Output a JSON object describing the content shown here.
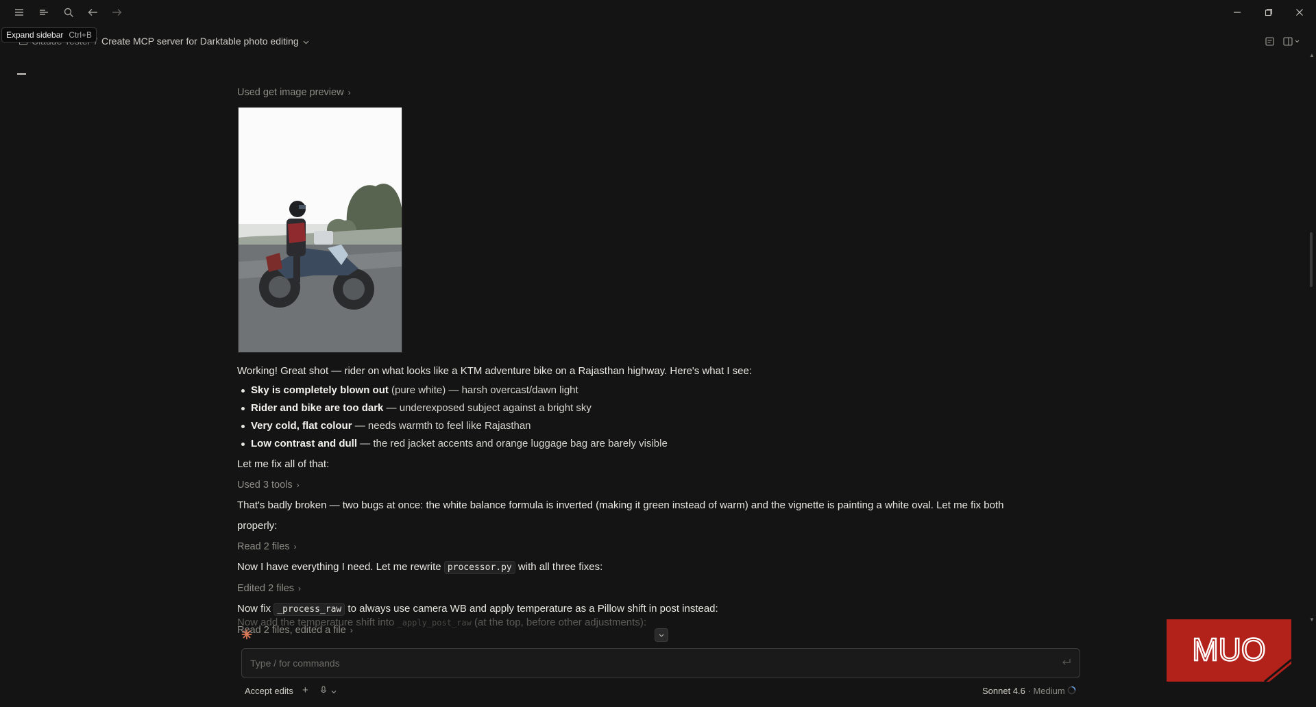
{
  "titlebar": {
    "icons": [
      "menu-icon",
      "list-icon",
      "search-icon",
      "back-arrow-icon",
      "forward-arrow-icon"
    ],
    "window_controls": [
      "minimize-icon",
      "restore-icon",
      "close-icon"
    ]
  },
  "tooltip": {
    "label": "Expand sidebar",
    "shortcut": "Ctrl+B"
  },
  "breadcrumb": {
    "project": "Claude Tester",
    "separator": "/",
    "title": "Create MCP server for Darktable photo editing"
  },
  "conversation": {
    "tool_preview": "Used get image preview",
    "intro": "Working! Great shot — rider on what looks like a KTM adventure bike on a Rajasthan highway. Here's what I see:",
    "bullets": [
      {
        "bold": "Sky is completely blown out",
        "rest": " (pure white) — harsh overcast/dawn light"
      },
      {
        "bold": "Rider and bike are too dark",
        "rest": " — underexposed subject against a bright sky"
      },
      {
        "bold": "Very cold, flat colour",
        "rest": " — needs warmth to feel like Rajasthan"
      },
      {
        "bold": "Low contrast and dull",
        "rest": " — the red jacket accents and orange luggage bag are barely visible"
      }
    ],
    "fix_all": "Let me fix all of that:",
    "used_tools": "Used 3 tools",
    "broken": "That's badly broken — two bugs at once: the white balance formula is inverted (making it green instead of warm) and the vignette is painting a white oval. Let me fix both properly:",
    "read_files": "Read 2 files",
    "rewrite_pre": "Now I have everything I need. Let me rewrite ",
    "rewrite_code": "processor.py",
    "rewrite_post": " with all three fixes:",
    "edited": "Edited 2 files",
    "fixraw_pre": "Now fix ",
    "fixraw_code": "_process_raw",
    "fixraw_post": " to always use camera WB and apply temperature as a Pillow shift in post instead:",
    "read_edit": "Read 2 files, edited a file",
    "faded_pre": "Now add the temperature shift into ",
    "faded_code": "_apply_post_raw",
    "faded_post": " (at the top, before other adjustments):"
  },
  "composer": {
    "placeholder": "Type / for commands",
    "accept_edits": "Accept edits",
    "model": "Sonnet 4.6",
    "effort": "· Medium"
  },
  "watermark": {
    "text": "MUO"
  },
  "colors": {
    "background": "#141414",
    "text": "#e8e6e1",
    "muted": "#8f8d87",
    "accent": "#d97757",
    "watermark": "#b3211b"
  }
}
